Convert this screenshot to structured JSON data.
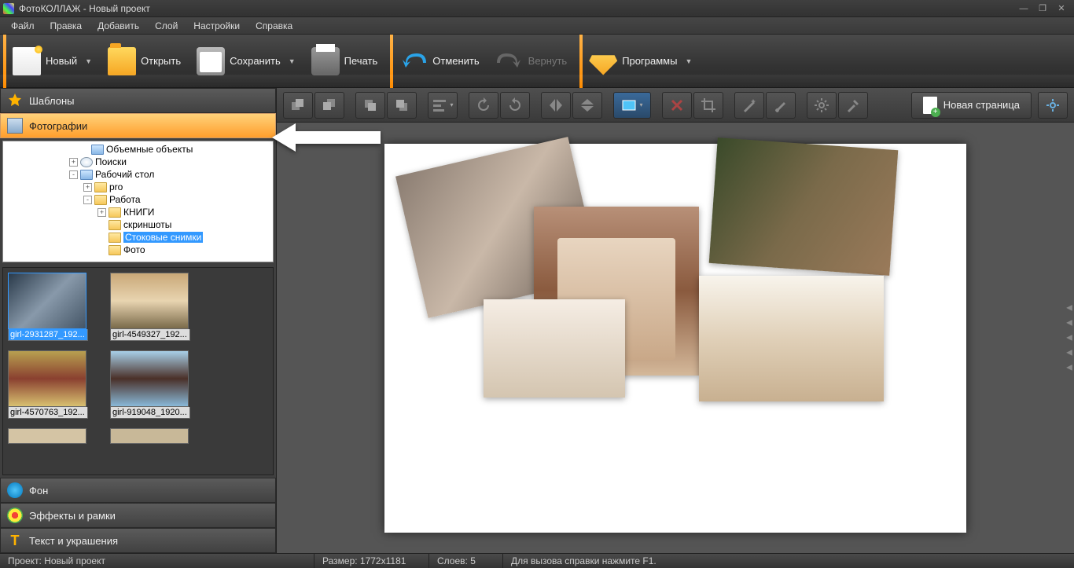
{
  "title": "ФотоКОЛЛАЖ - Новый проект",
  "menu": [
    "Файл",
    "Правка",
    "Добавить",
    "Слой",
    "Настройки",
    "Справка"
  ],
  "toolbar": {
    "new": "Новый",
    "open": "Открыть",
    "save": "Сохранить",
    "print": "Печать",
    "undo": "Отменить",
    "redo": "Вернуть",
    "apps": "Программы"
  },
  "accordion": {
    "templates": "Шаблоны",
    "photos": "Фотографии",
    "background": "Фон",
    "effects": "Эффекты и рамки",
    "text": "Текст и украшения"
  },
  "tree": {
    "items": [
      {
        "indent": 96,
        "exp": "",
        "icon": "drive",
        "label": "Объемные объекты"
      },
      {
        "indent": 82,
        "exp": "+",
        "icon": "search",
        "label": "Поиски"
      },
      {
        "indent": 82,
        "exp": "-",
        "icon": "drive",
        "label": "Рабочий стол"
      },
      {
        "indent": 100,
        "exp": "+",
        "icon": "folder",
        "label": "pro"
      },
      {
        "indent": 100,
        "exp": "-",
        "icon": "folder",
        "label": "Работа"
      },
      {
        "indent": 118,
        "exp": "+",
        "icon": "folder",
        "label": "КНИГИ"
      },
      {
        "indent": 118,
        "exp": "",
        "icon": "folder",
        "label": "скриншоты"
      },
      {
        "indent": 118,
        "exp": "",
        "icon": "folder",
        "label": "Стоковые снимки",
        "sel": true
      },
      {
        "indent": 118,
        "exp": "",
        "icon": "folder",
        "label": "Фото"
      }
    ]
  },
  "thumbs": [
    {
      "label": "girl-2931287_192...",
      "sel": true,
      "bg": "linear-gradient(135deg,#2a3a4a,#8899aa,#445566)"
    },
    {
      "label": "girl-4549327_192...",
      "bg": "linear-gradient(#c9a878,#e8d4b0,#7a6a4a)"
    },
    {
      "label": "girl-4570763_192...",
      "bg": "linear-gradient(#b8a050,#8a4030,#d8c070)"
    },
    {
      "label": "girl-919048_1920...",
      "bg": "linear-gradient(#a8d0e8,#4a3028,#88b8d8)"
    }
  ],
  "newpage": "Новая страница",
  "status": {
    "project": "Проект:  Новый проект",
    "size": "Размер:  1772x1181",
    "layers": "Слоев:  5",
    "help": "Для вызова справки нажмите F1."
  }
}
